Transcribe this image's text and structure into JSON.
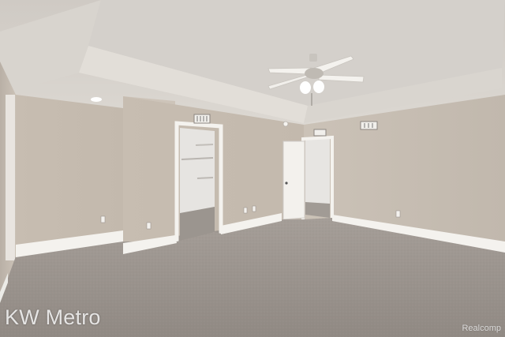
{
  "photo": {
    "subject": "Empty carpeted bedroom with tray ceiling, ceiling fan, walk-in closet and open doorway"
  },
  "watermarks": {
    "brand": "KW Metro",
    "source": "Realcomp"
  },
  "colors": {
    "wall": "#c9c0b5",
    "ceiling": "#d6d2cc",
    "carpet": "#9a938d",
    "trim": "#f4f2ee"
  }
}
